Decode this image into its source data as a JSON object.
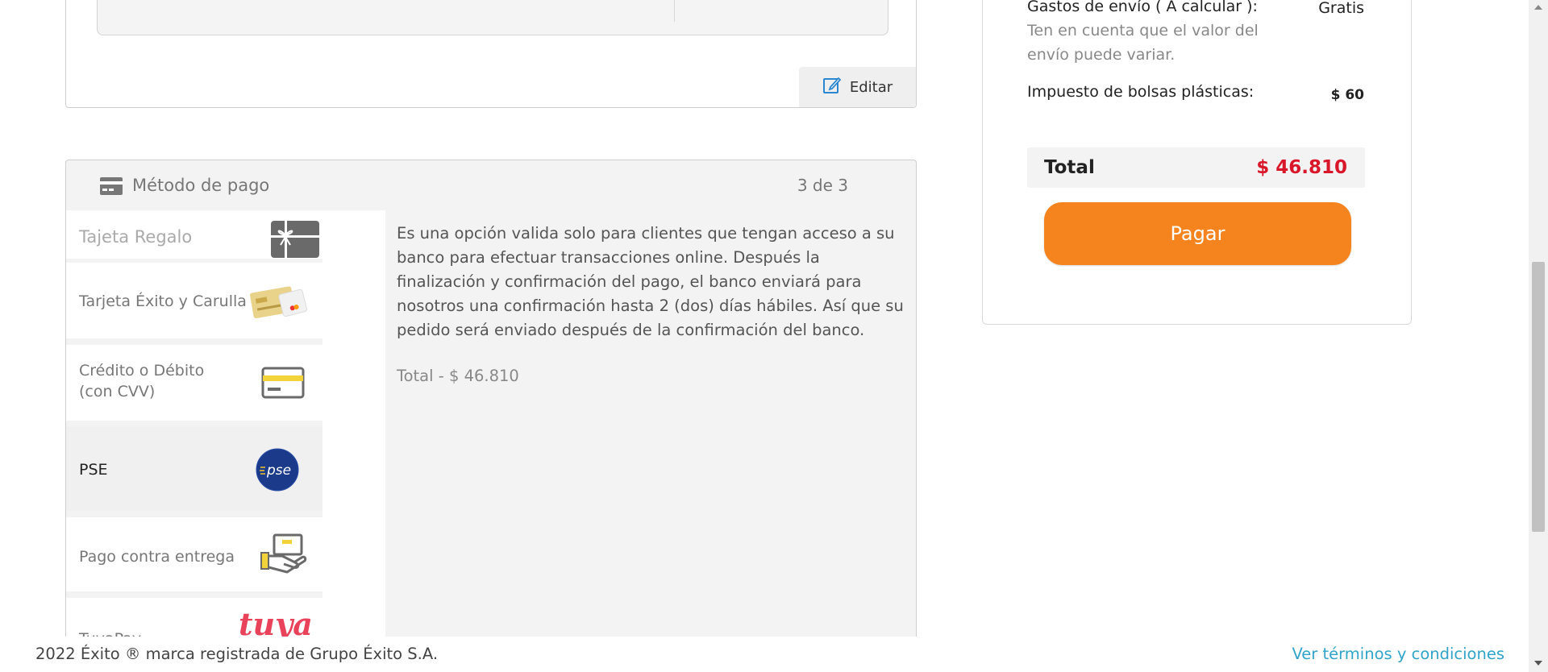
{
  "address_section": {
    "edit_label": "Editar"
  },
  "payment": {
    "title": "Método de pago",
    "step": "3 de 3",
    "methods": [
      {
        "label": "Tajeta Regalo",
        "icon": "gift-card-icon"
      },
      {
        "label": "Tarjeta Éxito y Carulla",
        "icon": "exito-card-icon"
      },
      {
        "label": "Crédito o Débito (con CVV)",
        "icon": "credit-card-icon"
      },
      {
        "label": "PSE",
        "icon": "pse-logo-icon"
      },
      {
        "label": "Pago contra entrega",
        "icon": "cash-on-delivery-icon"
      },
      {
        "label": "TuyaPay",
        "icon": "tuyapay-logo-icon"
      }
    ],
    "selected": "PSE",
    "description": "Es una opción valida solo para clientes que tengan acceso a su banco para efectuar transacciones online. Después la finalización y confirmación del pago, el banco enviará para nosotros una confirmación hasta 2 (dos) días hábiles. Así que su pedido será enviado después de la confirmación del banco.",
    "total_text": "Total - $ 46.810"
  },
  "summary": {
    "shipping_label": "Gastos de envío ( A calcular ):",
    "shipping_value": "Gratis",
    "shipping_note": "Ten en cuenta que el valor del envío puede variar.",
    "bag_tax_label": "Impuesto de bolsas plásticas:",
    "bag_tax_value": "$ 60",
    "total_label": "Total",
    "total_value": "$ 46.810",
    "pay_button": "Pagar"
  },
  "footer": {
    "copyright": "2022 Éxito ® marca registrada de Grupo Éxito S.A.",
    "terms_link": "Ver términos y condiciones"
  },
  "colors": {
    "accent_orange": "#f5841f",
    "total_red": "#d9172a",
    "link_blue": "#31a3c9",
    "tuya_pink": "#e8435a",
    "pse_blue": "#1b3a8a"
  }
}
